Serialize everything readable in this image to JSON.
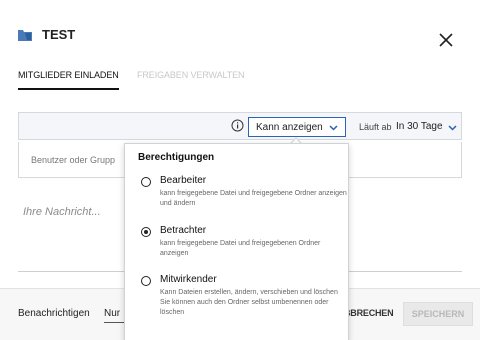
{
  "header": {
    "title": "TEST",
    "folder_icon": "shared-folder-icon",
    "close_icon": "close-icon"
  },
  "tabs": [
    {
      "label": "MITGLIEDER EINLADEN",
      "active": true
    },
    {
      "label": "FREIGABEN VERWALTEN",
      "active": false
    }
  ],
  "permission_bar": {
    "info_icon": "info-icon",
    "selected_permission": "Kann anzeigen",
    "expiry_label": "Läuft ab",
    "expiry_value": "In 30 Tage"
  },
  "user_input": {
    "placeholder": "Benutzer oder Grupp"
  },
  "message": {
    "placeholder": "Ihre Nachricht..."
  },
  "permissions_dropdown": {
    "title": "Berechtigungen",
    "options": [
      {
        "name": "Bearbeiter",
        "description": "kann freigegebene Datei und freigegebene Ordner anzeigen und ändern",
        "selected": false
      },
      {
        "name": "Betrachter",
        "description": "kann freigegebene Datei und freigegebenen Ordner anzeigen",
        "selected": true
      },
      {
        "name": "Mitwirkender",
        "description": "Kann Dateien erstellen, ändern, verschieben und löschen",
        "description2": "Sie können auch den Ordner selbst umbenennen oder löschen",
        "selected": false
      }
    ]
  },
  "footer": {
    "notify_label": "Benachrichtigen",
    "notify_value": "Nur",
    "cancel_label": "BBRECHEN",
    "save_label": "SPEICHERN"
  },
  "colors": {
    "accent": "#2a63b8",
    "folder": "#4a7ab8"
  }
}
